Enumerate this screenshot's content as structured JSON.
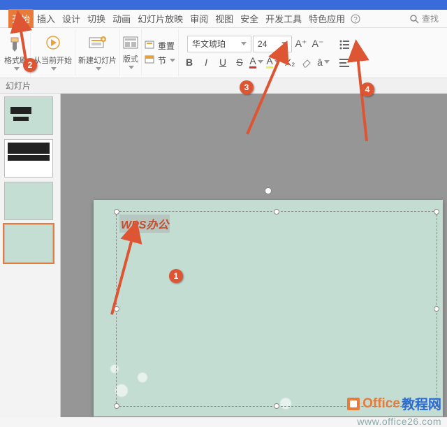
{
  "tabs": {
    "home": "开始",
    "insert": "插入",
    "design": "设计",
    "transition": "切换",
    "animation": "动画",
    "slideshow": "幻灯片放映",
    "review": "审阅",
    "view": "视图",
    "security": "安全",
    "developer": "开发工具",
    "special": "特色应用"
  },
  "search": {
    "label": "查找"
  },
  "ribbon": {
    "format_painter": "格式刷",
    "from_current": "从当前开始",
    "new_slide": "新建幻灯片",
    "layout": "版式",
    "section": "节",
    "reset": "重置",
    "font_name": "华文琥珀",
    "font_size": "24"
  },
  "secondary": {
    "panel": "幻灯片"
  },
  "slide": {
    "text": "WPS办公"
  },
  "callouts": {
    "c1": "1",
    "c2": "2",
    "c3": "3",
    "c4": "4"
  },
  "watermark": {
    "brand1": "Office",
    "brand2": "教程网",
    "url": "www.office26.com"
  }
}
